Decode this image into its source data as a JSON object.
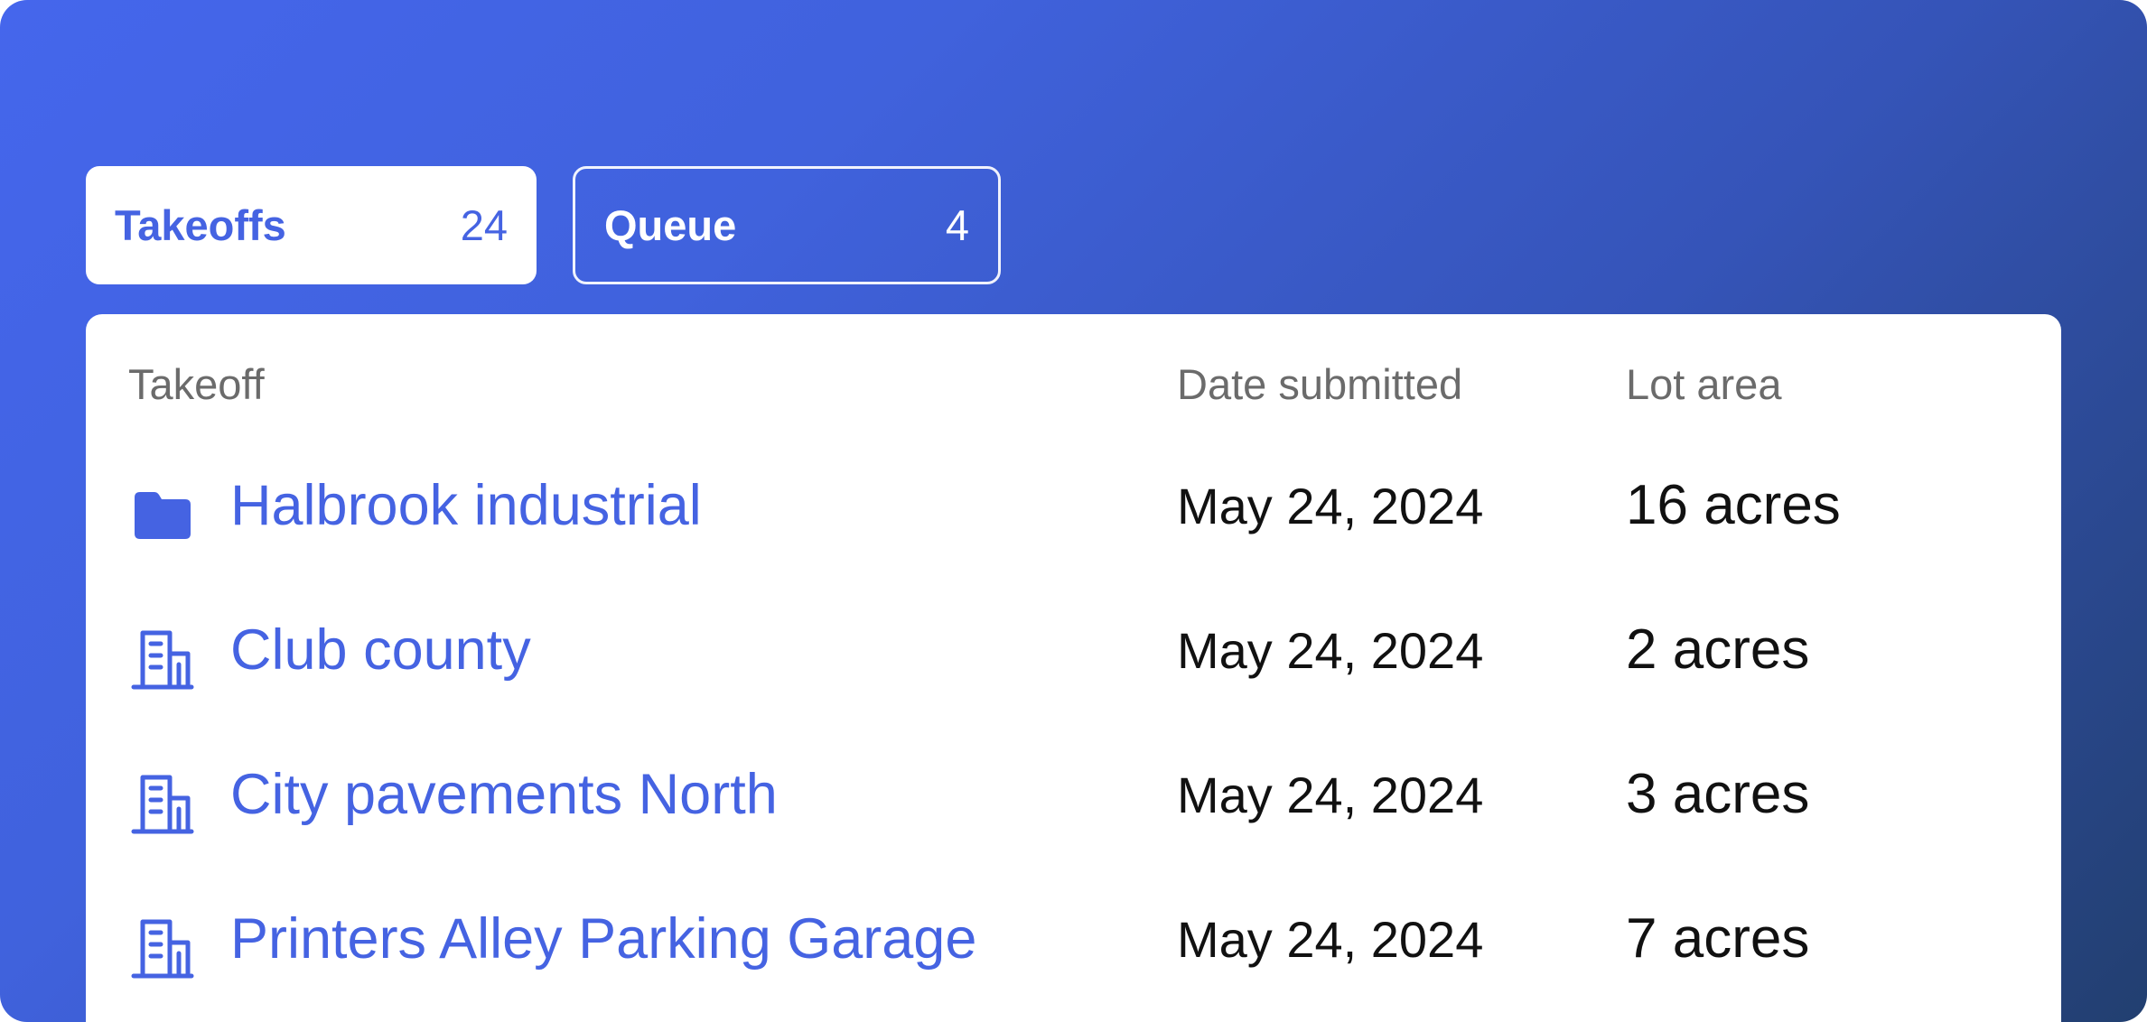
{
  "tabs": [
    {
      "label": "Takeoffs",
      "count": "24",
      "active": true
    },
    {
      "label": "Queue",
      "count": "4",
      "active": false
    }
  ],
  "table": {
    "columns": [
      "Takeoff",
      "Date submitted",
      "Lot area"
    ],
    "rows": [
      {
        "icon": "folder-icon",
        "name": "Halbrook industrial",
        "date": "May 24, 2024",
        "area": "16 acres"
      },
      {
        "icon": "building-icon",
        "name": "Club county",
        "date": "May 24, 2024",
        "area": "2 acres"
      },
      {
        "icon": "building-icon",
        "name": "City pavements North",
        "date": "May 24, 2024",
        "area": "3 acres"
      },
      {
        "icon": "building-icon",
        "name": "Printers Alley Parking Garage",
        "date": "May 24, 2024",
        "area": "7 acres"
      }
    ]
  },
  "colors": {
    "accent": "#4563e2",
    "gradient_start": "#4566ec",
    "gradient_end": "#223f70",
    "header_text": "#6b6b6b",
    "body_text": "#111111"
  }
}
